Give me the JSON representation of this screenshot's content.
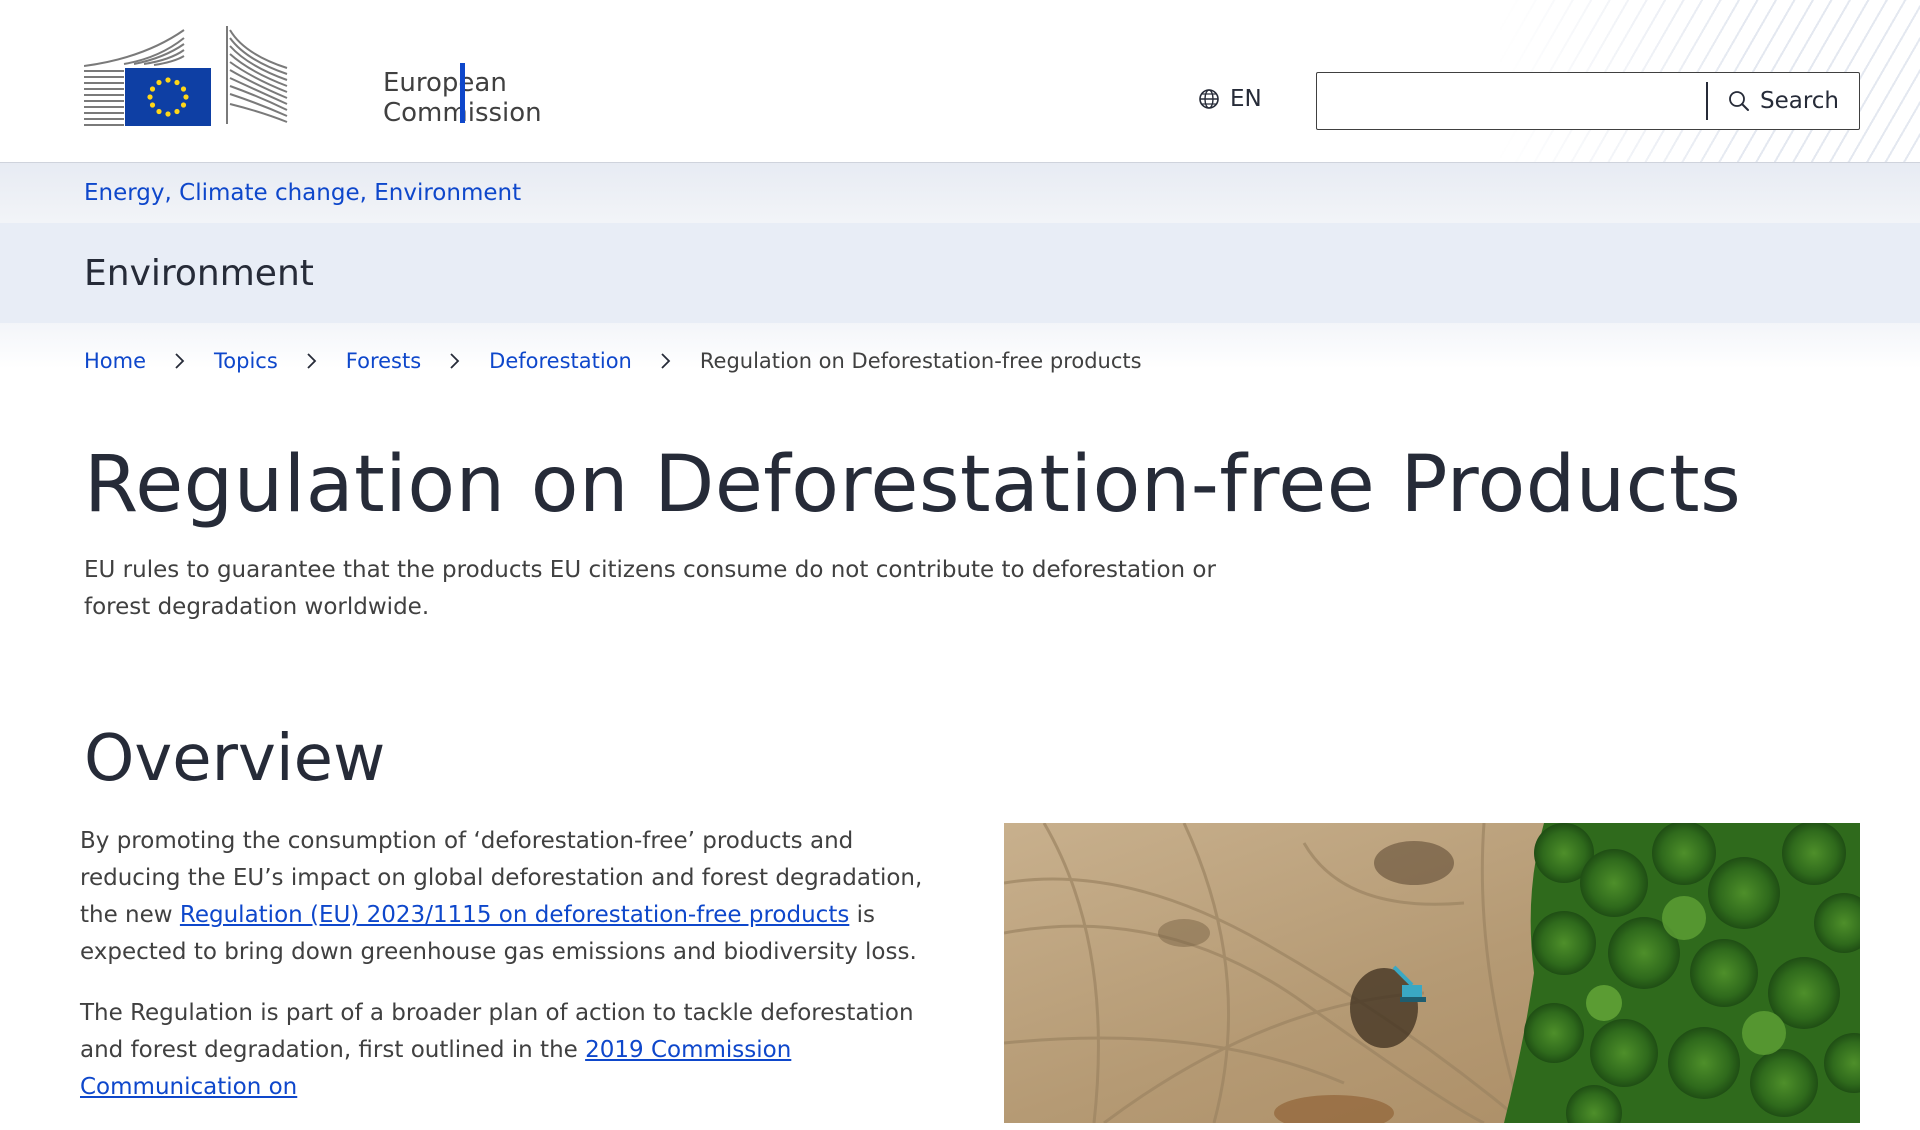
{
  "header": {
    "logo_line1": "European",
    "logo_line2": "Commission",
    "language": "EN",
    "search": {
      "placeholder": "",
      "button_label": "Search"
    }
  },
  "site": {
    "topics": "Energy, Climate change, Environment",
    "section_title": "Environment"
  },
  "breadcrumb": {
    "items": [
      "Home",
      "Topics",
      "Forests",
      "Deforestation"
    ],
    "current": "Regulation on Deforestation-free products"
  },
  "page": {
    "title": "Regulation on Deforestation-free Products",
    "intro": "EU rules to guarantee that the products EU citizens consume do not contribute to deforestation or forest degradation worldwide."
  },
  "overview": {
    "heading": "Overview",
    "p1_before": "By promoting the consumption of ‘deforestation-free’ products and reducing the EU’s impact on global deforestation and forest degradation, the new ",
    "p1_link": "Regulation (EU) 2023/1115 on deforestation-free products",
    "p1_after": " is expected to bring down greenhouse gas emissions and biodiversity loss.",
    "p2_before": "The Regulation is part of a broader plan of action to tackle deforestation and forest degradation, first outlined in the ",
    "p2_link": "2019 Commission Communication on"
  },
  "colors": {
    "link": "#0e47cb",
    "text": "#262b38",
    "band": "#e8edf6"
  },
  "icons": {
    "language": "globe-icon",
    "search": "search-icon",
    "breadcrumb_separator": "chevron-right-icon"
  }
}
